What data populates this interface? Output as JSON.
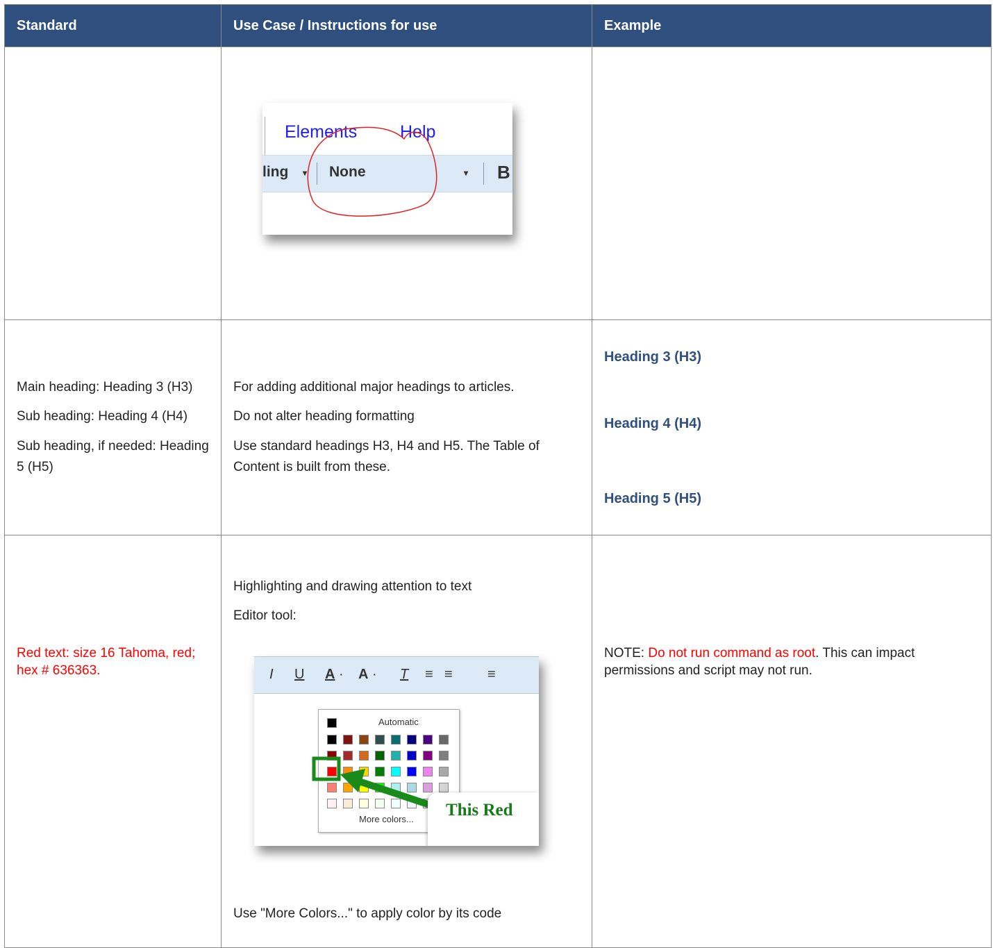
{
  "table": {
    "headers": [
      "Standard",
      "Use Case / Instructions for use",
      "Example"
    ]
  },
  "row1": {
    "screenshot": {
      "tabs": [
        "Elements",
        "Help"
      ],
      "toolbar_left": "ling",
      "dropdown_value": "None",
      "bold_glyph": "B"
    }
  },
  "row2": {
    "standard": [
      "Main heading: Heading 3 (H3)",
      "Sub heading: Heading 4 (H4)",
      "Sub heading, if needed: Heading 5 (H5)"
    ],
    "usecase": [
      "For adding additional major headings to articles.",
      "Do not alter heading formatting",
      "Use standard headings H3, H4 and H5. The Table of Content is built from these."
    ],
    "examples": [
      "Heading 3 (H3)",
      "Heading 4 (H4)",
      "Heading 5 (H5)"
    ]
  },
  "row3": {
    "standard": "Red text: size 16 Tahoma, red; hex # 636363.",
    "usecase_intro": "Highlighting and drawing attention to text",
    "usecase_tool": "Editor tool:",
    "usecase_more": "Use \"More Colors...\" to apply color by its code",
    "example_prefix": "NOTE: ",
    "example_red": "Do not run command as root",
    "example_suffix": ". This can impact permissions and script may not run.",
    "screenshot": {
      "palette_automatic": "Automatic",
      "palette_more": "More colors...",
      "callout": "This Red",
      "toolbar_glyphs": [
        "I",
        "U",
        "A",
        "·",
        "A",
        "·",
        "T",
        "≡",
        "≡",
        "≡"
      ]
    }
  },
  "colors": {
    "header_bg": "#2f4f7e",
    "heading_blue": "#2f4f7e",
    "red": "#ff0000"
  }
}
